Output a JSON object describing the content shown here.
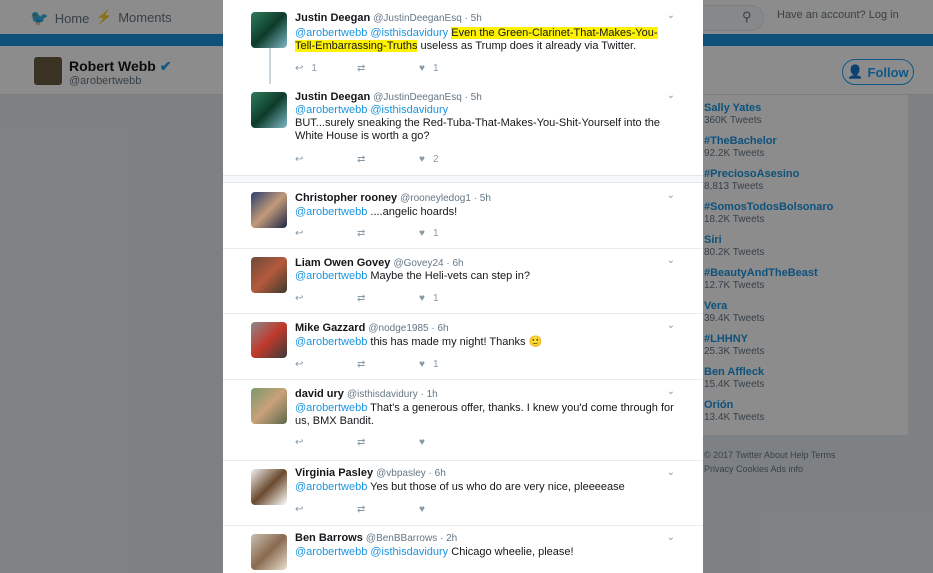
{
  "nav": {
    "home": "Home",
    "moments": "Moments",
    "login": "Have an account? Log in"
  },
  "profile": {
    "name": "Robert Webb",
    "handle": "@arobertwebb",
    "follow": "Follow"
  },
  "trends": [
    {
      "name": "Sally Yates",
      "count": "360K Tweets"
    },
    {
      "name": "#TheBachelor",
      "count": "92.2K Tweets"
    },
    {
      "name": "#PreciosoAsesino",
      "count": "8,813 Tweets"
    },
    {
      "name": "#SomosTodosBolsonaro",
      "count": "18.2K Tweets"
    },
    {
      "name": "Siri",
      "count": "80.2K Tweets"
    },
    {
      "name": "#BeautyAndTheBeast",
      "count": "12.7K Tweets"
    },
    {
      "name": "Vera",
      "count": "39.4K Tweets"
    },
    {
      "name": "#LHHNY",
      "count": "25.3K Tweets"
    },
    {
      "name": "Ben Affleck",
      "count": "15.4K Tweets"
    },
    {
      "name": "Orión",
      "count": "13.4K Tweets"
    }
  ],
  "footer": {
    "line1": "© 2017 Twitter   About   Help   Terms",
    "line2": "Privacy   Cookies   Ads info"
  },
  "tweets": [
    {
      "name": "Justin Deegan",
      "handle": "@JustinDeeganEsq · 5h",
      "mentions": "@arobertwebb @isthisdavidury",
      "highlight": "Even the Green-Clarinet-That-Makes-You-Tell-Embarrassing-Truths",
      "text": " useless as Trump does it already via Twitter.",
      "replies": "1",
      "likes": "1"
    },
    {
      "name": "Justin Deegan",
      "handle": "@JustinDeeganEsq · 5h",
      "mentions": "@arobertwebb @isthisdavidury",
      "text": "BUT...surely sneaking the Red-Tuba-That-Makes-You-Shit-Yourself into the White House is worth a go?",
      "replies": "",
      "likes": "2"
    },
    {
      "name": "Christopher rooney",
      "handle": "@rooneyledog1 · 5h",
      "mentions": "@arobertwebb",
      "text": " ....angelic hoards!",
      "replies": "",
      "likes": "1"
    },
    {
      "name": "Liam Owen Govey",
      "handle": "@Govey24 · 6h",
      "mentions": "@arobertwebb",
      "text": " Maybe the Heli-vets can step in?",
      "replies": "",
      "likes": "1"
    },
    {
      "name": "Mike Gazzard",
      "handle": "@nodge1985 · 6h",
      "mentions": "@arobertwebb",
      "text": " this has made my night! Thanks 🙂",
      "replies": "",
      "likes": "1"
    },
    {
      "name": "david ury",
      "handle": "@isthisdavidury · 1h",
      "mentions": "@arobertwebb",
      "text": " That's a generous offer, thanks. I knew you'd come through for us, BMX Bandit.",
      "replies": "",
      "likes": ""
    },
    {
      "name": "Virginia Pasley",
      "handle": "@vbpasley · 6h",
      "mentions": "@arobertwebb",
      "text": " Yes but those of us who do are very nice, pleeeease",
      "replies": "",
      "likes": ""
    },
    {
      "name": "Ben Barrows",
      "handle": "@BenBBarrows · 2h",
      "mentions": "@arobertwebb @isthisdavidury",
      "text": " Chicago wheelie, please!",
      "replies": "",
      "likes": ""
    }
  ]
}
